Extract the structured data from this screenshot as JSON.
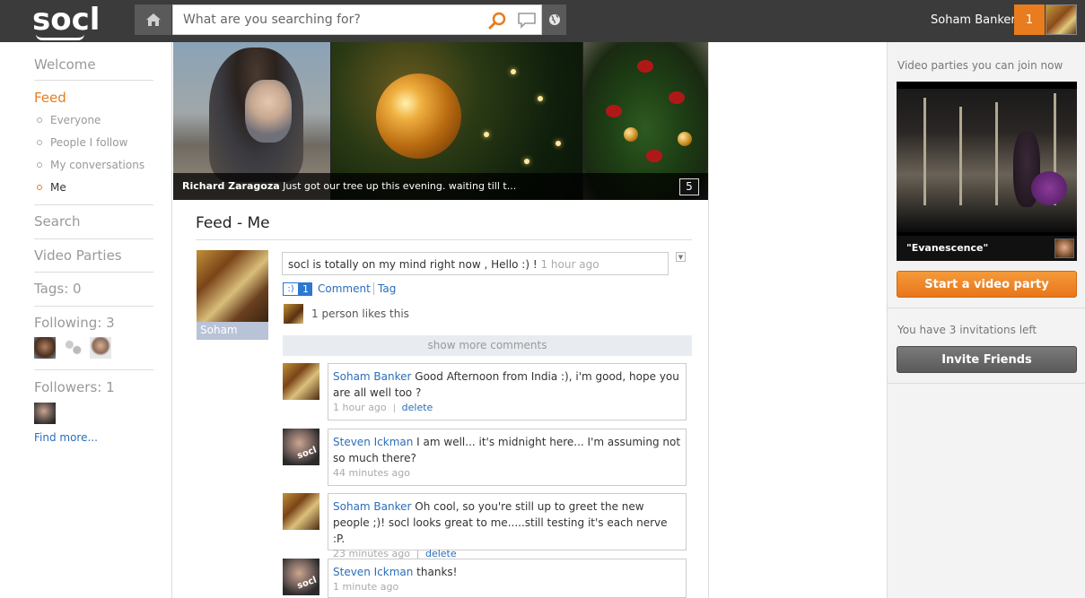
{
  "topbar": {
    "logo": "socl",
    "search_placeholder": "What are you searching for?",
    "user_name": "Soham Banker",
    "notification_count": "1",
    "icons": [
      "home-icon",
      "search-icon",
      "chat-icon",
      "globe-icon"
    ]
  },
  "leftnav": {
    "welcome": "Welcome",
    "feed": "Feed",
    "feed_items": [
      "Everyone",
      "People I follow",
      "My conversations",
      "Me"
    ],
    "active_feed_item": "Me",
    "search": "Search",
    "video_parties": "Video Parties",
    "tags": "Tags: 0",
    "following": "Following: 3",
    "followers": "Followers: 1",
    "find_more": "Find more..."
  },
  "banner": {
    "author": "Richard Zaragoza",
    "caption": "Just got our tree up this evening. waiting till t...",
    "count": "5"
  },
  "feed": {
    "title": "Feed - Me",
    "post": {
      "author_label": "Soham",
      "text": "socl is totally on my mind right now , Hello :) !",
      "time": "1 hour ago",
      "smile": ":)",
      "like_count": "1",
      "comment_label": "Comment",
      "tag_label": "Tag",
      "likes_text": "1 person likes this",
      "show_more": "show more comments"
    },
    "comments": [
      {
        "author": "Soham Banker",
        "text": "Good Afternoon from India :), i'm good, hope you are all well too ?",
        "time": "1 hour ago",
        "delete": "delete"
      },
      {
        "author": "Steven Ickman",
        "text": "I am well... it's midnight here... I'm assuming not so much there?",
        "time": "44 minutes ago",
        "delete": ""
      },
      {
        "author": "Soham Banker",
        "text": "Oh cool, so you're still up to greet the new people ;)! socl looks great to me.....still testing it's each nerve :P.",
        "time": "23 minutes ago",
        "delete": "delete"
      },
      {
        "author": "Steven Ickman",
        "text": "thanks!",
        "time": "1 minute ago",
        "delete": ""
      }
    ]
  },
  "rightpanel": {
    "title": "Video parties you can join now",
    "video_caption": "\"Evanescence\"",
    "start_button": "Start a video party",
    "invitations_text": "You have 3 invitations left",
    "invite_button": "Invite Friends"
  },
  "colors": {
    "topbar": "#3b3b3b",
    "accent_orange": "#e87c1e",
    "link_blue": "#2a6ebb"
  }
}
